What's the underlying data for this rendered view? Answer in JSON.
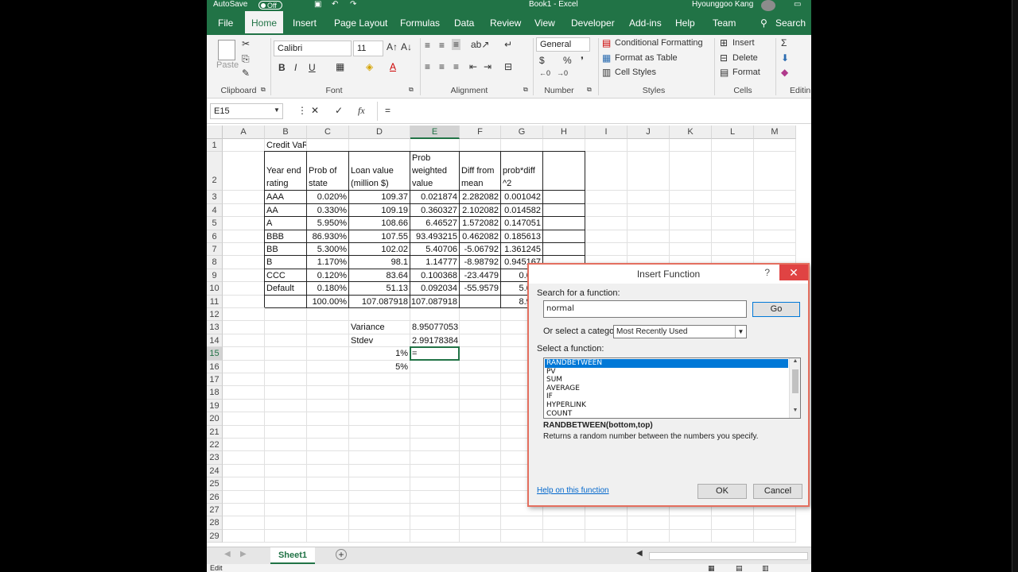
{
  "titlebar": {
    "autosave": "AutoSave",
    "autosave_state": "Off",
    "doc_title": "Book1 - Excel",
    "user": "Hyounggoo Kang"
  },
  "tabs": [
    "File",
    "Home",
    "Insert",
    "Page Layout",
    "Formulas",
    "Data",
    "Review",
    "View",
    "Developer",
    "Add-ins",
    "Help",
    "Team"
  ],
  "search_label": "Search",
  "ribbon": {
    "clipboard": {
      "paste": "Paste",
      "group": "Clipboard"
    },
    "font": {
      "name": "Calibri",
      "size": "11",
      "bold": "B",
      "italic": "I",
      "underline": "U",
      "group": "Font"
    },
    "alignment": {
      "group": "Alignment"
    },
    "number": {
      "format": "General",
      "group": "Number"
    },
    "styles": {
      "conditional": "Conditional Formatting",
      "table": "Format as Table",
      "cell": "Cell Styles",
      "group": "Styles"
    },
    "cells": {
      "insert": "Insert",
      "delete": "Delete",
      "format": "Format",
      "group": "Cells"
    },
    "editing": {
      "group": "Editin"
    }
  },
  "formula_bar": {
    "name_box": "E15",
    "cancel": "✕",
    "enter": "✓",
    "fx": "fx",
    "content": "="
  },
  "columns": [
    "A",
    "B",
    "C",
    "D",
    "E",
    "F",
    "G",
    "H",
    "I",
    "J",
    "K",
    "L",
    "M"
  ],
  "selected_column": "E",
  "selected_row": 15,
  "rows": 29,
  "cells": {
    "title": "Credit VaR",
    "headers": {
      "b": [
        "Year end",
        "rating"
      ],
      "c": [
        "Prob of",
        "state"
      ],
      "d": [
        "Loan value",
        "(million $)"
      ],
      "e": [
        "Prob",
        "weighted",
        "value"
      ],
      "f": [
        "Diff from",
        "mean"
      ],
      "g": [
        "prob*diff",
        "^2"
      ]
    },
    "table": [
      [
        "AAA",
        "0.020%",
        "109.37",
        "0.021874",
        "2.282082",
        "0.001042"
      ],
      [
        "AA",
        "0.330%",
        "109.19",
        "0.360327",
        "2.102082",
        "0.014582"
      ],
      [
        "A",
        "5.950%",
        "108.66",
        "6.46527",
        "1.572082",
        "0.147051"
      ],
      [
        "BBB",
        "86.930%",
        "107.55",
        "93.493215",
        "0.462082",
        "0.185613"
      ],
      [
        "BB",
        "5.300%",
        "102.02",
        "5.40706",
        "-5.06792",
        "1.361245"
      ],
      [
        "B",
        "1.170%",
        "98.1",
        "1.14777",
        "-8.98792",
        "0.945167"
      ],
      [
        "CCC",
        "0.120%",
        "83.64",
        "0.100368",
        "-23.4479",
        "0.659"
      ],
      [
        "Default",
        "0.180%",
        "51.13",
        "0.092034",
        "-55.9579",
        "5.636"
      ]
    ],
    "totals": {
      "c": "100.00%",
      "d": "107.087918",
      "e": "107.087918",
      "g": "8.950"
    },
    "variance_label": "Variance",
    "variance_value": "8.95077053",
    "stdev_label": "Stdev",
    "stdev_value": "2.99178384",
    "pct1": "1%",
    "pct5": "5%",
    "edit_value": "="
  },
  "sheet_tab": "Sheet1",
  "status": "Edit",
  "dialog": {
    "title": "Insert Function",
    "help_glyph": "?",
    "close_glyph": "✕",
    "search_label": "Search for a function:",
    "search_value": "normal",
    "go": "Go",
    "category_label": "Or select a category:",
    "category_value": "Most Recently Used",
    "select_label": "Select a function:",
    "functions": [
      "RANDBETWEEN",
      "PV",
      "SUM",
      "AVERAGE",
      "IF",
      "HYPERLINK",
      "COUNT"
    ],
    "selected_function": "RANDBETWEEN",
    "signature": "RANDBETWEEN(bottom,top)",
    "description": "Returns a random number between the numbers you specify.",
    "help_link": "Help on this function",
    "ok": "OK",
    "cancel": "Cancel"
  }
}
